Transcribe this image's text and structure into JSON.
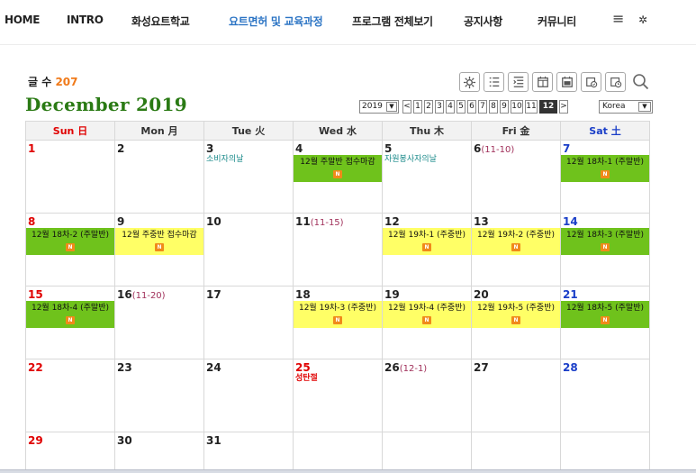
{
  "nav": {
    "items": [
      "HOME",
      "INTRO",
      "화성요트학교",
      "요트면허 및 교육과정",
      "프로그램 전체보기",
      "공지사항",
      "커뮤니티"
    ],
    "menu_icon": "≡",
    "settings_icon": "✲"
  },
  "post_count": {
    "label": "글 수",
    "value": "207"
  },
  "month_title": "December 2019",
  "toolbar": {
    "icons": [
      "gear-icon",
      "list-icon",
      "list-indent-icon",
      "calendar-month-icon",
      "calendar-day-icon",
      "calendar-check-icon",
      "calendar-clock-icon",
      "search-icon"
    ]
  },
  "pager": {
    "year": "2019",
    "months": [
      "<",
      "1",
      "2",
      "3",
      "4",
      "5",
      "6",
      "7",
      "8",
      "9",
      "10",
      "11",
      "12",
      ">"
    ],
    "current_month": "12",
    "country": "Korea"
  },
  "weekdays": [
    "Sun 日",
    "Mon 月",
    "Tue 火",
    "Wed 水",
    "Thu 木",
    "Fri 金",
    "Sat 土"
  ],
  "weeks": [
    [
      {
        "day": "1"
      },
      {
        "day": "2"
      },
      {
        "day": "3",
        "note": "소비자의날"
      },
      {
        "day": "4",
        "events": [
          {
            "text": "12월 주말반 접수마감",
            "color": "green"
          }
        ]
      },
      {
        "day": "5",
        "note": "자원봉사자의날"
      },
      {
        "day": "6",
        "sub": "(11-10)"
      },
      {
        "day": "7",
        "events": [
          {
            "text": "12월 18차-1 (주말반)",
            "color": "green"
          }
        ]
      }
    ],
    [
      {
        "day": "8",
        "events": [
          {
            "text": "12월 18차-2 (주말반)",
            "color": "green"
          }
        ]
      },
      {
        "day": "9",
        "events": [
          {
            "text": "12월 주중반 접수마감",
            "color": "yellow"
          }
        ]
      },
      {
        "day": "10"
      },
      {
        "day": "11",
        "sub": "(11-15)"
      },
      {
        "day": "12",
        "events": [
          {
            "text": "12월 19차-1 (주중반)",
            "color": "yellow"
          }
        ]
      },
      {
        "day": "13",
        "events": [
          {
            "text": "12월 19차-2 (주중반)",
            "color": "yellow"
          }
        ]
      },
      {
        "day": "14",
        "events": [
          {
            "text": "12월 18차-3 (주말반)",
            "color": "green"
          }
        ]
      }
    ],
    [
      {
        "day": "15",
        "events": [
          {
            "text": "12월 18차-4 (주말반)",
            "color": "green"
          }
        ]
      },
      {
        "day": "16",
        "sub": "(11-20)"
      },
      {
        "day": "17"
      },
      {
        "day": "18",
        "events": [
          {
            "text": "12월 19차-3 (주중반)",
            "color": "yellow"
          }
        ]
      },
      {
        "day": "19",
        "events": [
          {
            "text": "12월 19차-4 (주중반)",
            "color": "yellow"
          }
        ]
      },
      {
        "day": "20",
        "events": [
          {
            "text": "12월 19차-5 (주중반)",
            "color": "yellow"
          }
        ]
      },
      {
        "day": "21",
        "events": [
          {
            "text": "12월 18차-5 (주말반)",
            "color": "green"
          }
        ]
      }
    ],
    [
      {
        "day": "22"
      },
      {
        "day": "23"
      },
      {
        "day": "24"
      },
      {
        "day": "25",
        "holiday": "성탄절"
      },
      {
        "day": "26",
        "sub": "(12-1)"
      },
      {
        "day": "27"
      },
      {
        "day": "28"
      }
    ],
    [
      {
        "day": "29"
      },
      {
        "day": "30"
      },
      {
        "day": "31"
      },
      {},
      {},
      {},
      {}
    ]
  ],
  "badge_text": "N",
  "colors": {
    "accent_green": "#6fc21c",
    "event_yellow": "#ffff66",
    "title_green": "#2a7a14",
    "count_orange": "#f07a1a"
  }
}
